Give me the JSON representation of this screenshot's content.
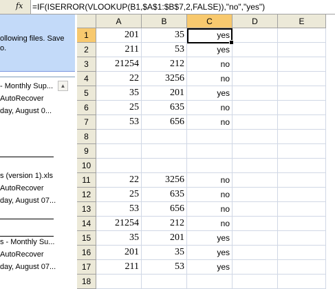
{
  "formula_bar": {
    "fx_label": "fx",
    "formula": "=IF(ISERROR(VLOOKUP(B1,$A$1:$B$7,2,FALSE)),\"no\",\"yes\")"
  },
  "task_pane": {
    "intro_line1": "ollowing files.  Save",
    "intro_line2": "o.",
    "files": [
      {
        "name": "- Monthly Sup...",
        "status": "AutoRecover",
        "date": "day, August 0..."
      },
      {
        "name": "s (version 1).xls",
        "status": "AutoRecover",
        "date": "day, August 07..."
      },
      {
        "name": "s - Monthly Su...",
        "status": "AutoRecover",
        "date": "day, August 07..."
      }
    ]
  },
  "sheet": {
    "columns": [
      "A",
      "B",
      "C",
      "D",
      "E"
    ],
    "active_cell": "C1",
    "rows": [
      {
        "num": "1",
        "a": "201",
        "b": "35",
        "c": "yes"
      },
      {
        "num": "2",
        "a": "211",
        "b": "53",
        "c": "yes"
      },
      {
        "num": "3",
        "a": "21254",
        "b": "212",
        "c": "no"
      },
      {
        "num": "4",
        "a": "22",
        "b": "3256",
        "c": "no"
      },
      {
        "num": "5",
        "a": "35",
        "b": "201",
        "c": "yes"
      },
      {
        "num": "6",
        "a": "25",
        "b": "635",
        "c": "no"
      },
      {
        "num": "7",
        "a": "53",
        "b": "656",
        "c": "no"
      },
      {
        "num": "8",
        "a": "",
        "b": "",
        "c": ""
      },
      {
        "num": "9",
        "a": "",
        "b": "",
        "c": ""
      },
      {
        "num": "10",
        "a": "",
        "b": "",
        "c": ""
      },
      {
        "num": "11",
        "a": "22",
        "b": "3256",
        "c": "no"
      },
      {
        "num": "12",
        "a": "25",
        "b": "635",
        "c": "no"
      },
      {
        "num": "13",
        "a": "53",
        "b": "656",
        "c": "no"
      },
      {
        "num": "14",
        "a": "21254",
        "b": "212",
        "c": "no"
      },
      {
        "num": "15",
        "a": "35",
        "b": "201",
        "c": "yes"
      },
      {
        "num": "16",
        "a": "201",
        "b": "35",
        "c": "yes"
      },
      {
        "num": "17",
        "a": "211",
        "b": "53",
        "c": "yes"
      },
      {
        "num": "18",
        "a": "",
        "b": "",
        "c": ""
      }
    ]
  },
  "colors": {
    "header_bg": "#ece9d8",
    "active_header_bg": "#f8c96e",
    "gridline": "#d0d7e5",
    "task_pane_header": "#c3daf9"
  }
}
